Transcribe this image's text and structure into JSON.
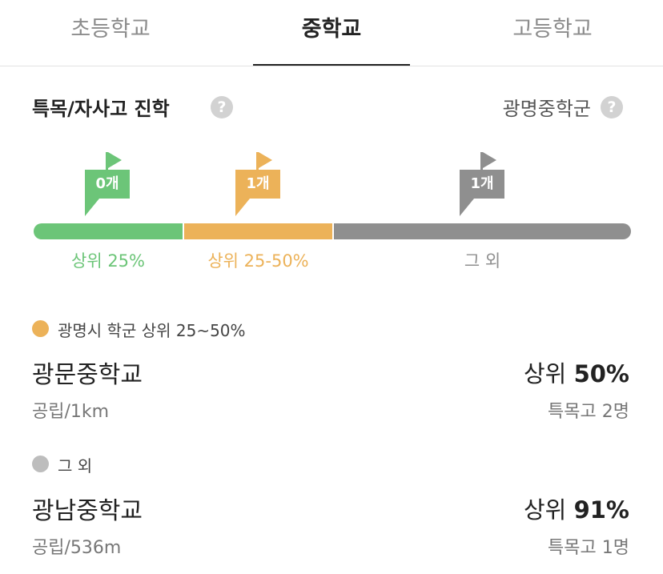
{
  "tabs": [
    {
      "label": "초등학교",
      "active": false
    },
    {
      "label": "중학교",
      "active": true
    },
    {
      "label": "고등학교",
      "active": false
    }
  ],
  "section": {
    "title": "특목/자사고 진학",
    "district": "광명중학군"
  },
  "flags": [
    {
      "count": "0개",
      "color": "#6cc578"
    },
    {
      "count": "1개",
      "color": "#ecb259"
    },
    {
      "count": "1개",
      "color": "#8f8f8f"
    }
  ],
  "bar": {
    "segments": [
      {
        "label": "상위 25%",
        "color": "#6cc578"
      },
      {
        "label": "상위 25-50%",
        "color": "#ecb259"
      },
      {
        "label": "그 외",
        "color": "#8f8f8f"
      }
    ]
  },
  "groups": [
    {
      "label": "광명시 학군 상위 25~50%",
      "dot_color": "#ecb259",
      "school": {
        "name": "광문중학교",
        "meta": "공립/1km",
        "rank_prefix": "상위",
        "rank_value": "50%",
        "special_count": "특목고 2명"
      }
    },
    {
      "label": "그 외",
      "dot_color": "#bdbdbd",
      "school": {
        "name": "광남중학교",
        "meta": "공립/536m",
        "rank_prefix": "상위",
        "rank_value": "91%",
        "special_count": "특목고 1명"
      }
    }
  ],
  "icons": {
    "help": "?"
  }
}
